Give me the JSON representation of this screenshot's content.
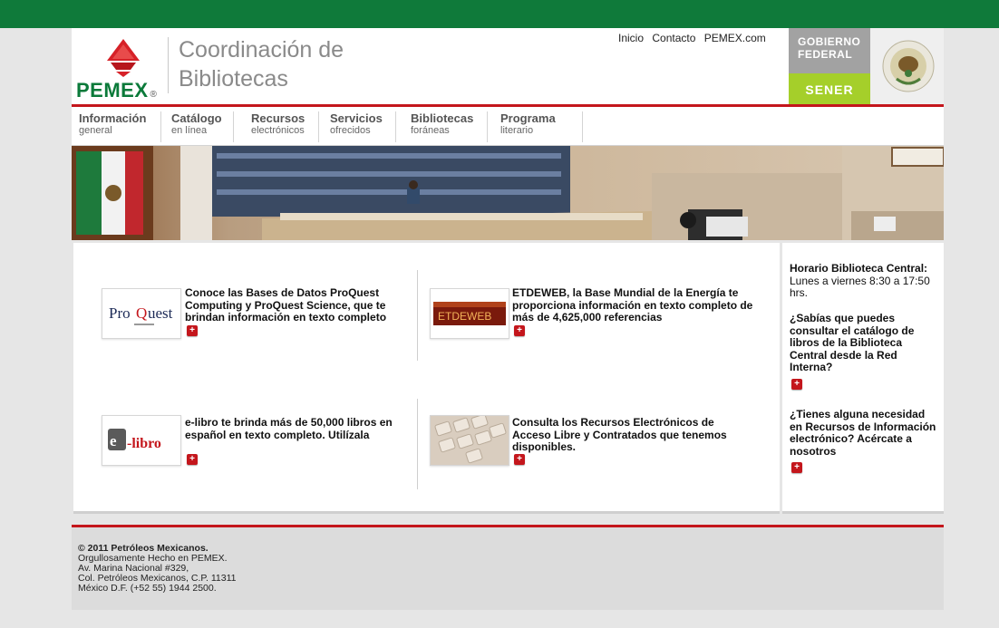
{
  "header": {
    "brand": "PEMEX",
    "brand_mark": "®",
    "title_line1": "Coordinación de",
    "title_line2": "Bibliotecas",
    "top_links": [
      "Inicio",
      "Contacto",
      "PEMEX.com"
    ],
    "gov_line1": "Gobierno",
    "gov_line2": "Federal",
    "gov_sener": "SENER"
  },
  "nav": {
    "items": [
      {
        "main": "Información",
        "sub": "general"
      },
      {
        "main": "Catálogo",
        "sub": "en línea"
      },
      {
        "main": "Recursos",
        "sub": "electrónicos"
      },
      {
        "main": "Servicios",
        "sub": "ofrecidos"
      },
      {
        "main": "Bibliotecas",
        "sub": "foráneas"
      },
      {
        "main": "Programa",
        "sub": "literario"
      }
    ]
  },
  "features": [
    {
      "logo": "ProQuest",
      "text": "Conoce las Bases de Datos ProQuest Computing y ProQuest Science, que te brindan información en texto completo"
    },
    {
      "logo": "ETDEWEB",
      "text": "ETDEWEB, la Base Mundial de la Energía te proporciona información en texto completo de más de 4,625,000 referencias"
    },
    {
      "logo": "e-libro",
      "text": "e-libro te brinda más de 50,000 libros en español en texto completo. Utilízala"
    },
    {
      "logo": "keyboard",
      "text": "Consulta los Recursos Electrónicos de Acceso Libre y Contratados que tenemos disponibles."
    }
  ],
  "sidebar": {
    "horario_title": "Horario Biblioteca Central:",
    "horario_text": "Lunes a viernes 8:30 a 17:50 hrs.",
    "tip1": "¿Sabías que puedes consultar el catálogo de libros de la Biblioteca Central desde la Red Interna?",
    "tip2": "¿Tienes alguna necesidad en Recursos de Información electrónico? Acércate a nosotros"
  },
  "footer": {
    "copyright": "© 2011 Petróleos Mexicanos.",
    "lines": [
      "Orgullosamente Hecho en PEMEX.",
      "Av. Marina Nacional #329,",
      "Col. Petróleos Mexicanos, C.P. 11311",
      "México D.F. (+52 55) 1944 2500."
    ]
  },
  "colors": {
    "green": "#0f7a3a",
    "red": "#c4161c",
    "sener": "#a5cf2a"
  },
  "icons": {
    "plus": "+",
    "more": "plus-icon"
  }
}
